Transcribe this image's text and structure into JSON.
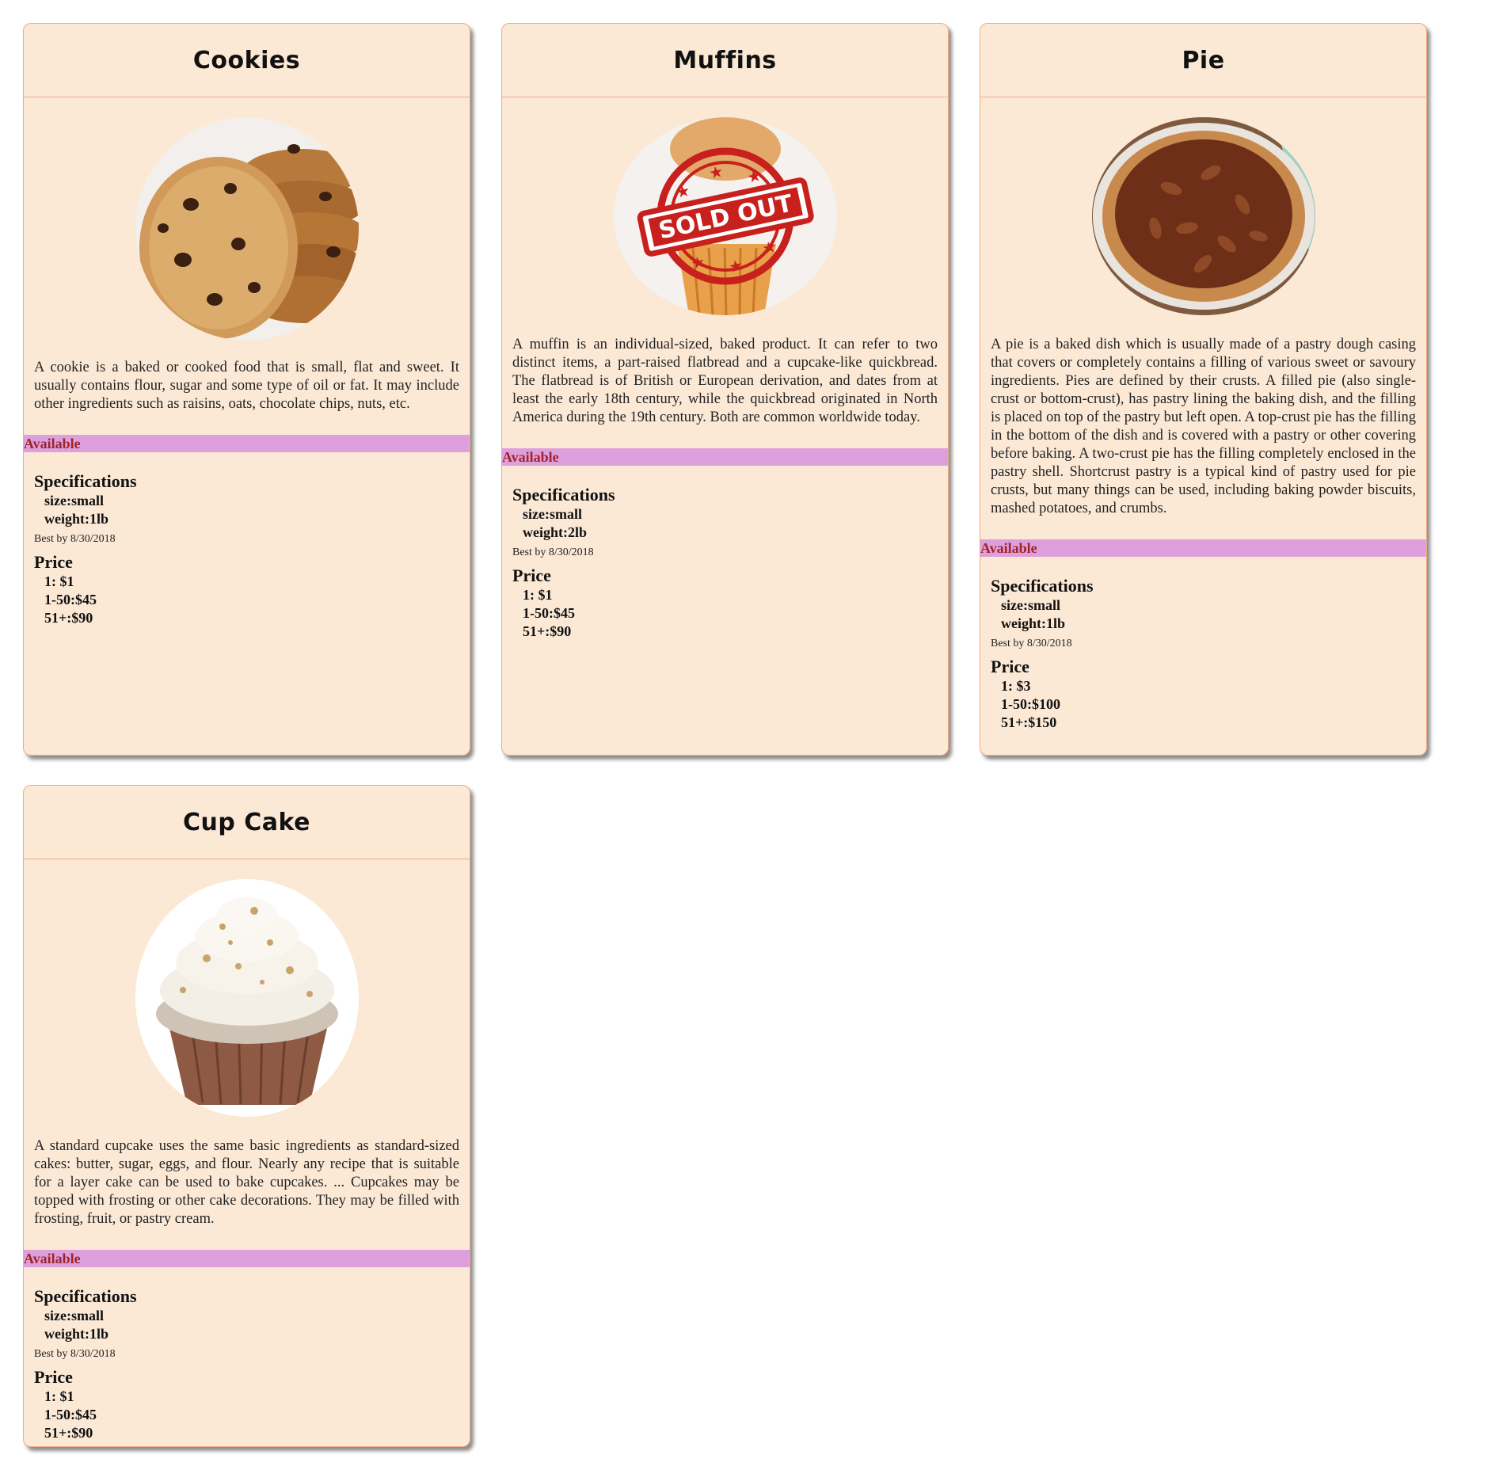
{
  "products": [
    {
      "title": "Cookies",
      "image_icon": "cookie-photo",
      "description": "A cookie is a baked or cooked food that is small, flat and sweet. It usually contains flour, sugar and some type of oil or fat. It may include other ingredients such as raisins, oats, chocolate chips, nuts, etc.",
      "status": "Available",
      "specs_title": "Specifications",
      "size": "size:small",
      "weight": "weight:1lb",
      "best_by": "Best by 8/30/2018",
      "price_title": "Price",
      "prices": [
        "1: $1",
        "1-50:$45",
        "51+:$90"
      ]
    },
    {
      "title": "Muffins",
      "image_icon": "muffin-photo",
      "overlay_text": "SOLD OUT",
      "description": "A muffin is an individual-sized, baked product. It can refer to two distinct items, a part-raised flatbread and a cupcake-like quickbread. The flatbread is of British or European derivation, and dates from at least the early 18th century, while the quickbread originated in North America during the 19th century. Both are common worldwide today.",
      "status": "Available",
      "specs_title": "Specifications",
      "size": "size:small",
      "weight": "weight:2lb",
      "best_by": "Best by 8/30/2018",
      "price_title": "Price",
      "prices": [
        "1: $1",
        "1-50:$45",
        "51+:$90"
      ]
    },
    {
      "title": "Pie",
      "image_icon": "pie-photo",
      "description": "A pie is a baked dish which is usually made of a pastry dough casing that covers or completely contains a filling of various sweet or savoury ingredients. Pies are defined by their crusts. A filled pie (also single-crust or bottom-crust), has pastry lining the baking dish, and the filling is placed on top of the pastry but left open. A top-crust pie has the filling in the bottom of the dish and is covered with a pastry or other covering before baking. A two-crust pie has the filling completely enclosed in the pastry shell. Shortcrust pastry is a typical kind of pastry used for pie crusts, but many things can be used, including baking powder biscuits, mashed potatoes, and crumbs.",
      "status": "Available",
      "specs_title": "Specifications",
      "size": "size:small",
      "weight": "weight:1lb",
      "best_by": "Best by 8/30/2018",
      "price_title": "Price",
      "prices": [
        "1: $3",
        "1-50:$100",
        "51+:$150"
      ]
    },
    {
      "title": "Cup Cake",
      "image_icon": "cupcake-photo",
      "description": "A standard cupcake uses the same basic ingredients as standard-sized cakes: butter, sugar, eggs, and flour. Nearly any recipe that is suitable for a layer cake can be used to bake cupcakes. ... Cupcakes may be topped with frosting or other cake decorations. They may be filled with frosting, fruit, or pastry cream.",
      "status": "Available",
      "specs_title": "Specifications",
      "size": "size:small",
      "weight": "weight:1lb",
      "best_by": "Best by 8/30/2018",
      "price_title": "Price",
      "prices": [
        "1: $1",
        "1-50:$45",
        "51+:$90"
      ]
    }
  ],
  "colors": {
    "card_bg": "#fbe9d6",
    "card_border": "#f0ab86",
    "status_bar": "#dda0dd",
    "status_text": "#a0232a",
    "stamp_red": "#c8201c"
  }
}
